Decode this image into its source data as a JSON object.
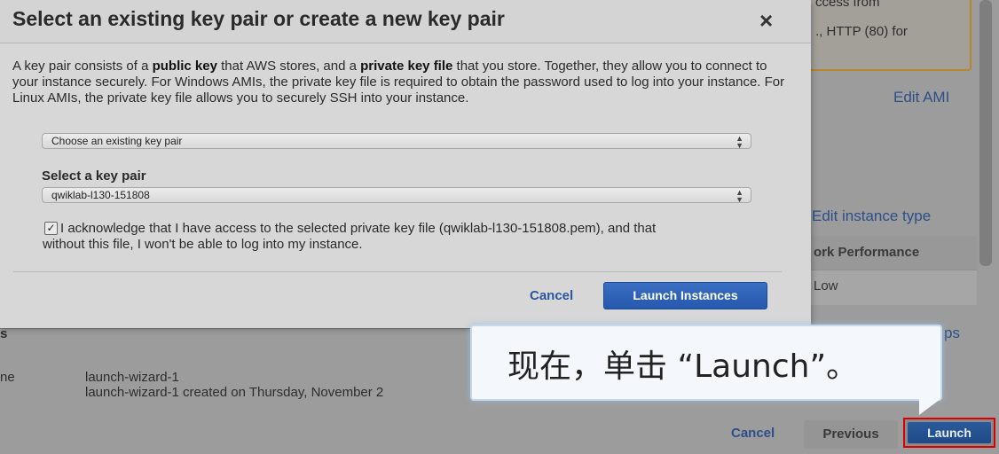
{
  "modal": {
    "title": "Select an existing key pair or create a new key pair",
    "close_label": "×",
    "description": {
      "p1": "A key pair consists of a ",
      "b1": "public key",
      "p2": " that AWS stores, and a ",
      "b2": "private key file",
      "p3": " that you store. Together, they allow you to connect to your instance securely. For Windows AMIs, the private key file is required to obtain the password used to log into your instance. For Linux AMIs, the private key file allows you to securely SSH into your instance."
    },
    "key_option_select": {
      "value": "Choose an existing key pair"
    },
    "key_pair_label": "Select a key pair",
    "key_pair_select": {
      "value": "qwiklab-l130-151808"
    },
    "acknowledge_checked": true,
    "acknowledge_text": "I acknowledge that I have access to the selected private key file (qwiklab-l130-151808.pem), and that without this file, I won't be able to log into my instance.",
    "cancel_label": "Cancel",
    "launch_label": "Launch Instances"
  },
  "background": {
    "notice_line1": "ccess from",
    "notice_line2": "., HTTP (80) for",
    "edit_ami": "Edit AMI",
    "edit_instance_type": "Edit instance type",
    "table_header": "ork Performance",
    "table_cell": "Low",
    "partial_ps": "ps",
    "partial_s": "s",
    "row_label": "ne",
    "security_group_name": "launch-wizard-1",
    "security_group_desc": "launch-wizard-1 created on Thursday, November 2"
  },
  "footer": {
    "cancel_label": "Cancel",
    "previous_label": "Previous",
    "launch_label": "Launch"
  },
  "callout": {
    "text": "现在，单击 “Launch”。"
  }
}
